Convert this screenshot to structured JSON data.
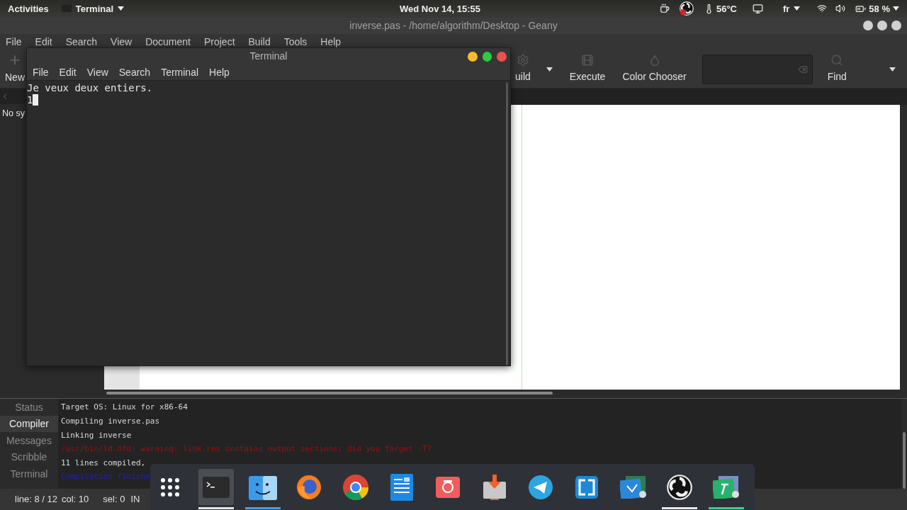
{
  "top_bar": {
    "activities": "Activities",
    "app_menu": "Terminal",
    "clock": "Wed Nov 14, 15:55",
    "temperature": "56°C",
    "keyboard": "fr",
    "battery": "58 %"
  },
  "geany": {
    "title": "inverse.pas - /home/algorithm/Desktop - Geany",
    "menu": [
      "File",
      "Edit",
      "Search",
      "View",
      "Document",
      "Project",
      "Build",
      "Tools",
      "Help"
    ],
    "new_label": "New",
    "toolbar": [
      {
        "kind": "build",
        "label": "uild"
      },
      {
        "kind": "execute",
        "label": "Execute"
      },
      {
        "kind": "color",
        "label": "Color Chooser"
      }
    ],
    "find_label": "Find",
    "sidebar_text": "No sy",
    "message_tabs": [
      {
        "label": "Status",
        "selected": false
      },
      {
        "label": "Compiler",
        "selected": true
      },
      {
        "label": "Messages",
        "selected": false
      },
      {
        "label": "Scribble",
        "selected": false
      },
      {
        "label": "Terminal",
        "selected": false
      }
    ],
    "messages": [
      {
        "kind": "normal",
        "text": "Target OS: Linux for x86-64"
      },
      {
        "kind": "normal",
        "text": "Compiling inverse.pas"
      },
      {
        "kind": "normal",
        "text": "Linking inverse"
      },
      {
        "kind": "error",
        "text": "/usr/bin/ld.bfd: warning: link.res contains output sections; did you forget -T?"
      },
      {
        "kind": "normal",
        "text": "11 lines compiled,"
      },
      {
        "kind": "info",
        "text": "Compilation finishe"
      }
    ],
    "status": [
      "line: 8 / 12",
      "col: 10",
      "sel: 0",
      "IN"
    ]
  },
  "terminal": {
    "title": "Terminal",
    "menu": [
      "File",
      "Edit",
      "View",
      "Search",
      "Terminal",
      "Help"
    ],
    "lines": [
      "Je veux deux entiers.",
      "1"
    ]
  },
  "dock": [
    {
      "kind": "apps",
      "selected": false
    },
    {
      "kind": "terminal",
      "selected": true,
      "color": "#e8e8e8"
    },
    {
      "kind": "files",
      "selected": false,
      "color": "#4a9fe0"
    },
    {
      "kind": "fox",
      "selected": false
    },
    {
      "kind": "chrome",
      "selected": false
    },
    {
      "kind": "document",
      "selected": false
    },
    {
      "kind": "camera",
      "selected": false
    },
    {
      "kind": "download",
      "selected": false
    },
    {
      "kind": "plane",
      "selected": false
    },
    {
      "kind": "brackets",
      "selected": false
    },
    {
      "kind": "code",
      "selected": false
    },
    {
      "kind": "obs",
      "selected": false,
      "color": "#e8e8e8"
    },
    {
      "kind": "hammer",
      "selected": false,
      "color": "#3ecf8e"
    }
  ]
}
